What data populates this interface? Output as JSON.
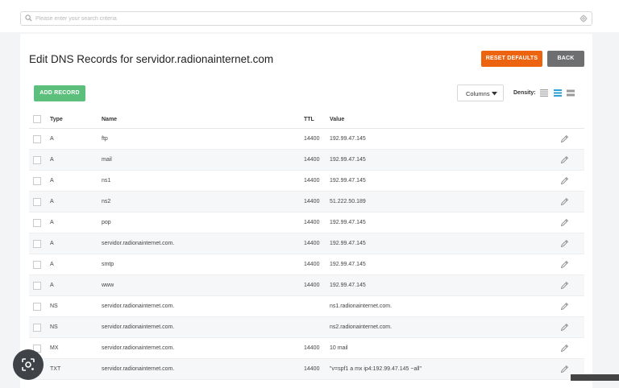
{
  "search": {
    "placeholder": "Please enter your search criteria"
  },
  "page": {
    "title": "Edit DNS Records for servidor.radionainternet.com"
  },
  "buttons": {
    "reset": "RESET DEFAULTS",
    "back": "BACK",
    "add": "ADD RECORD"
  },
  "toolbar": {
    "columns_label": "Columns",
    "density_label": "Density:"
  },
  "table": {
    "headers": {
      "type": "Type",
      "name": "Name",
      "ttl": "TTL",
      "value": "Value"
    },
    "rows": [
      {
        "type": "A",
        "name": "ftp",
        "ttl": "14400",
        "value": "192.99.47.145"
      },
      {
        "type": "A",
        "name": "mail",
        "ttl": "14400",
        "value": "192.99.47.145"
      },
      {
        "type": "A",
        "name": "ns1",
        "ttl": "14400",
        "value": "192.99.47.145"
      },
      {
        "type": "A",
        "name": "ns2",
        "ttl": "14400",
        "value": "51.222.50.189"
      },
      {
        "type": "A",
        "name": "pop",
        "ttl": "14400",
        "value": "192.99.47.145"
      },
      {
        "type": "A",
        "name": "servidor.radionainternet.com.",
        "ttl": "14400",
        "value": "192.99.47.145"
      },
      {
        "type": "A",
        "name": "smtp",
        "ttl": "14400",
        "value": "192.99.47.145"
      },
      {
        "type": "A",
        "name": "www",
        "ttl": "14400",
        "value": "192.99.47.145"
      },
      {
        "type": "NS",
        "name": "servidor.radionainternet.com.",
        "ttl": "",
        "value": "ns1.radionainternet.com."
      },
      {
        "type": "NS",
        "name": "servidor.radionainternet.com.",
        "ttl": "",
        "value": "ns2.radionainternet.com."
      },
      {
        "type": "MX",
        "name": "servidor.radionainternet.com.",
        "ttl": "14400",
        "value": "10 mail"
      },
      {
        "type": "TXT",
        "name": "servidor.radionainternet.com.",
        "ttl": "14400",
        "value": "\"v=spf1 a mx ip4:192.99.47.145 ~all\""
      }
    ]
  },
  "colors": {
    "reset": "#ec6410",
    "back": "#6e6f70",
    "add": "#5cbf7b",
    "density_active": "#2a9fd8"
  },
  "icons": {
    "search": "search-icon",
    "settings": "gear-icon",
    "edit": "pencil-icon",
    "lens": "lens-icon"
  }
}
